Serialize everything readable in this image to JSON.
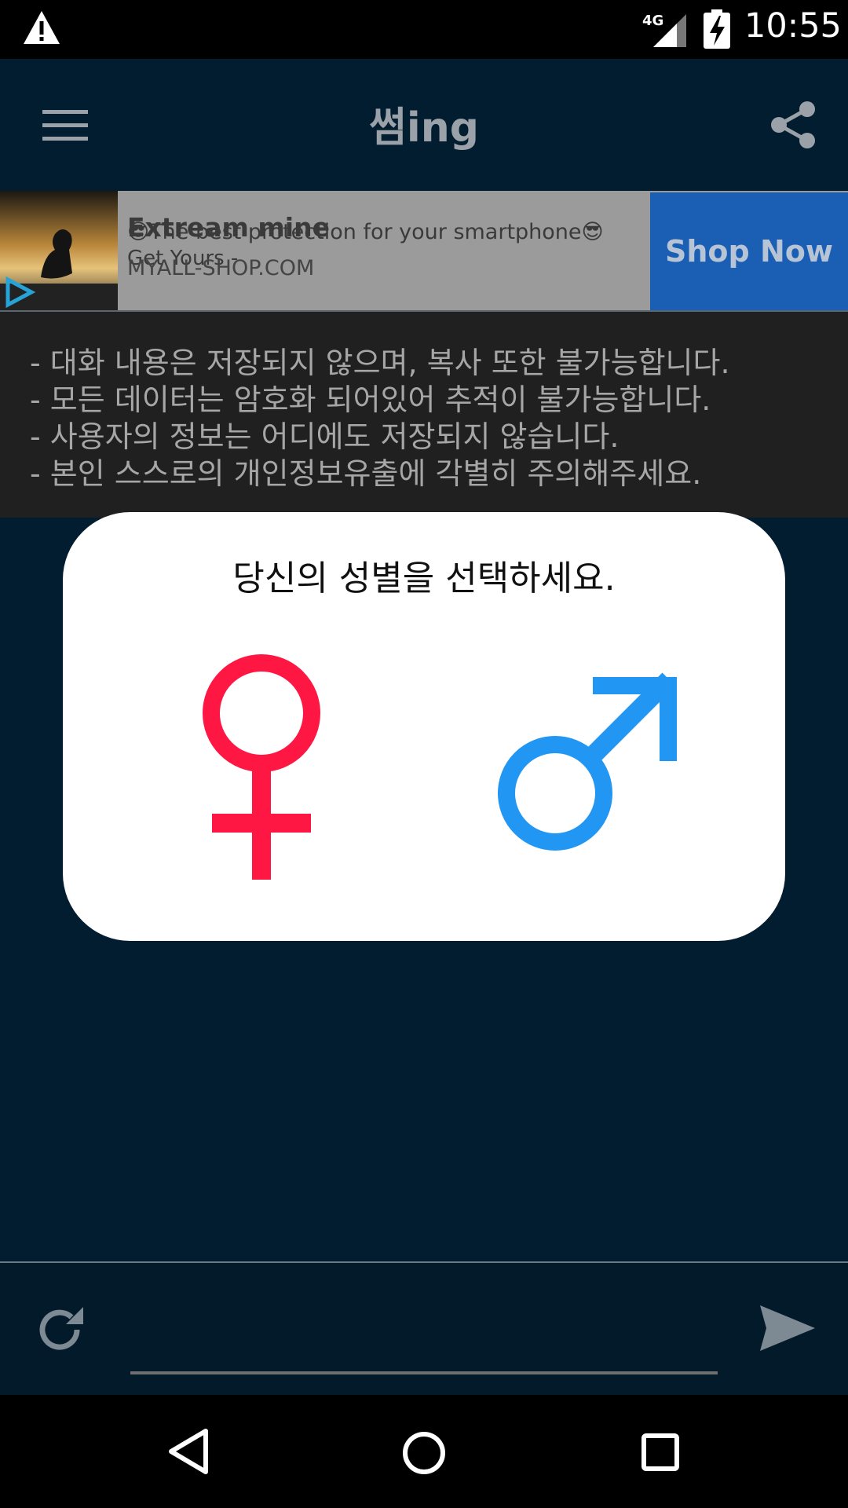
{
  "status_bar": {
    "time": "10:55",
    "network": "4G",
    "icons": [
      "warning-icon",
      "signal-icon",
      "battery-charging-icon"
    ]
  },
  "app_bar": {
    "title": "썸ing",
    "icons": [
      "menu-icon",
      "share-icon"
    ]
  },
  "ad": {
    "headline": "Extream mine",
    "subtext": "😎The best protection for your smartphone😎",
    "cta_line": "Get Yours -",
    "domain": "MYALL-SHOP.COM",
    "button_label": "Shop Now"
  },
  "notice": {
    "lines": [
      "- 대화 내용은 저장되지 않으며, 복사 또한 불가능합니다.",
      "- 모든 데이터는 암호화 되어있어 추적이 불가능합니다.",
      "- 사용자의 정보는 어디에도 저장되지 않습니다.",
      "- 본인 스스로의 개인정보유출에 각별히 주의해주세요."
    ]
  },
  "dialog": {
    "title": "당신의 성별을 선택하세요.",
    "options": [
      "female-symbol-icon",
      "male-symbol-icon"
    ],
    "colors": {
      "female": "#ff1744",
      "male": "#2196f3"
    }
  },
  "input_bar": {
    "value": "",
    "icons": [
      "refresh-icon",
      "send-icon"
    ]
  },
  "nav_bar": {
    "icons": [
      "back-icon",
      "home-icon",
      "recents-icon"
    ]
  },
  "colors": {
    "background": "#031d30",
    "ad_button": "#1a5fb4",
    "notice_background": "#202020"
  }
}
